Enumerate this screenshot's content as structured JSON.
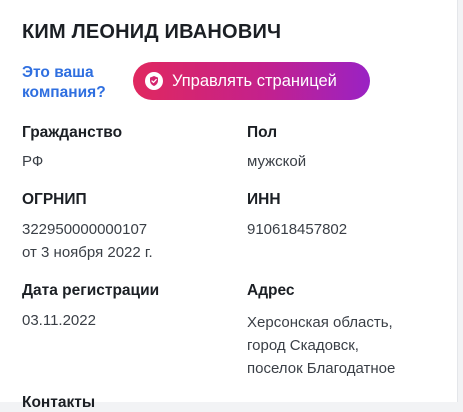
{
  "entity": {
    "title": "КИМ ЛЕОНИД ИВАНОВИЧ",
    "company_question": "Это ваша компания?",
    "manage_button_label": "Управлять страницей"
  },
  "fields": {
    "citizenship": {
      "label": "Гражданство",
      "value": "РФ"
    },
    "gender": {
      "label": "Пол",
      "value": "мужской"
    },
    "ogrnip": {
      "label": "ОГРНИП",
      "value": "322950000000107",
      "date": "от 3 ноября 2022 г."
    },
    "inn": {
      "label": "ИНН",
      "value": "910618457802"
    },
    "registration_date": {
      "label": "Дата регистрации",
      "value": "03.11.2022"
    },
    "address": {
      "label": "Адрес",
      "line1": "Херсонская область,",
      "line2": "город Скадовск,",
      "line3": "поселок Благодатное"
    }
  },
  "sections": {
    "contacts_label": "Контакты"
  },
  "icons": {
    "manage_button_icon": "shield-check-icon"
  },
  "colors": {
    "link": "#2f6fe0",
    "button_gradient_start": "#e0285f",
    "button_gradient_end": "#9a22c4"
  }
}
